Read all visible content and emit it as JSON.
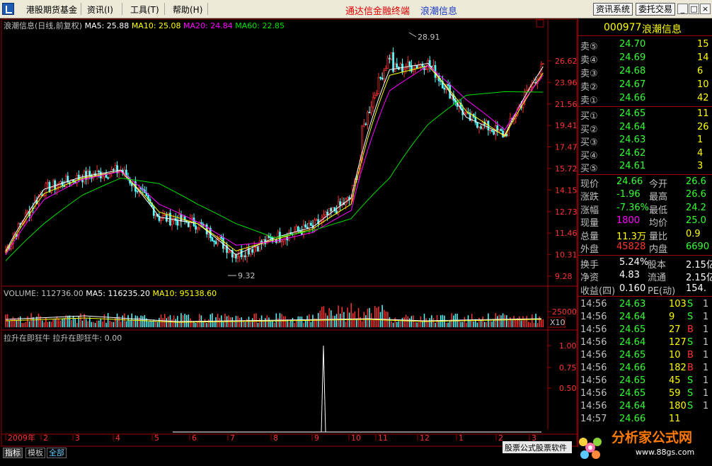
{
  "menu": {
    "items": [
      "港股期货基金",
      "资讯(I)",
      "工具(T)",
      "帮助(H)"
    ],
    "title_red": "通达信金融终端",
    "title_blue": "浪潮信息",
    "buttons": [
      "资讯系统",
      "委托交易"
    ],
    "window_controls": [
      "_",
      "□",
      "×"
    ]
  },
  "chart": {
    "header": {
      "name": "浪潮信息(日线,前复权)",
      "ma5": "MA5: 25.88",
      "ma10": "MA10: 25.08",
      "ma20": "MA20: 24.84",
      "ma60": "MA60: 22.85"
    },
    "price_ticks": [
      "26.62",
      "23.96",
      "21.56",
      "19.41",
      "17.47",
      "15.72",
      "14.15",
      "12.73",
      "11.46",
      "10.31",
      "9.28"
    ],
    "high_label": "28.91",
    "low_label": "9.32",
    "volume_header": {
      "vol": "VOLUME: 112736.00",
      "ma5": "MA5: 116235.20",
      "ma10": "MA10: 95138.60"
    },
    "volume_tick": "25000",
    "volume_unit": "X10",
    "indicator_header": "拉升在即狂牛  拉升在即狂牛: 0.00",
    "indicator_ticks": [
      "1.00",
      "0.75",
      "0.50"
    ],
    "months": [
      "2009年",
      "2",
      "3",
      "4",
      "5",
      "6",
      "7",
      "8",
      "9",
      "10",
      "11",
      "12",
      "1",
      "2",
      "3"
    ],
    "colors": {
      "up": "#ff3333",
      "down": "#54ffff",
      "ma5": "#ffffff",
      "ma10": "#ffff00",
      "ma20": "#ff00ff",
      "ma60": "#00e000",
      "grid": "#a00000"
    }
  },
  "chart_data": {
    "type": "line",
    "title": "浪潮信息(日线,前复权)",
    "ylim": [
      9.28,
      28.91
    ],
    "categories": [
      "2009-01",
      "2009-02",
      "2009-03",
      "2009-04",
      "2009-05",
      "2009-06",
      "2009-07",
      "2009-08",
      "2009-09",
      "2009-10",
      "2009-11",
      "2009-12",
      "2010-01",
      "2010-02",
      "2010-03"
    ],
    "series": [
      {
        "name": "MA5",
        "values": [
          10.5,
          14.2,
          15.1,
          15.6,
          12.4,
          12.0,
          10.3,
          11.2,
          11.8,
          13.6,
          25.5,
          26.3,
          20.2,
          18.5,
          25.88
        ]
      },
      {
        "name": "MA10",
        "values": [
          10.4,
          13.9,
          15.0,
          15.5,
          12.7,
          12.0,
          10.5,
          11.1,
          11.7,
          13.2,
          24.8,
          26.0,
          20.8,
          18.4,
          25.08
        ]
      },
      {
        "name": "MA20",
        "values": [
          10.3,
          13.5,
          14.9,
          15.5,
          13.2,
          12.1,
          10.8,
          11.0,
          11.5,
          12.8,
          23.0,
          26.0,
          22.0,
          19.0,
          24.84
        ]
      },
      {
        "name": "MA60",
        "values": [
          10.0,
          12.0,
          13.8,
          15.0,
          14.6,
          13.2,
          12.0,
          11.2,
          11.6,
          12.3,
          15.0,
          19.5,
          22.5,
          22.9,
          22.85
        ]
      }
    ],
    "indicator": {
      "name": "拉升在即狂牛",
      "signal_month": "2009-09",
      "value": 1.0
    }
  },
  "quote": {
    "code": "000977",
    "name": "浪潮信息",
    "sell": [
      {
        "label": "卖⑤",
        "price": "24.70",
        "vol": "15"
      },
      {
        "label": "卖④",
        "price": "24.69",
        "vol": "14"
      },
      {
        "label": "卖③",
        "price": "24.68",
        "vol": "6"
      },
      {
        "label": "卖②",
        "price": "24.67",
        "vol": "10"
      },
      {
        "label": "卖①",
        "price": "24.66",
        "vol": "42"
      }
    ],
    "buy": [
      {
        "label": "买①",
        "price": "24.65",
        "vol": "11"
      },
      {
        "label": "买②",
        "price": "24.64",
        "vol": "26"
      },
      {
        "label": "买③",
        "price": "24.63",
        "vol": "1"
      },
      {
        "label": "买④",
        "price": "24.62",
        "vol": "4"
      },
      {
        "label": "买⑤",
        "price": "24.61",
        "vol": "3"
      }
    ],
    "stats": [
      {
        "l1": "现价",
        "v1": "24.66",
        "c1": "#33ff33",
        "l2": "今开",
        "v2": "26.6",
        "c2": "#33ff33"
      },
      {
        "l1": "涨跌",
        "v1": "-1.96",
        "c1": "#33ff33",
        "l2": "最高",
        "v2": "26.6",
        "c2": "#33ff33"
      },
      {
        "l1": "涨幅",
        "v1": "-7.36%",
        "c1": "#33ff33",
        "l2": "最低",
        "v2": "24.2",
        "c2": "#33ff33"
      },
      {
        "l1": "现量",
        "v1": "1800",
        "c1": "#ff00ff",
        "l2": "均价",
        "v2": "25.0",
        "c2": "#33ff33"
      },
      {
        "l1": "总量",
        "v1": "11.3万",
        "c1": "#ffff00",
        "l2": "量比",
        "v2": "0.9",
        "c2": "#ffff00"
      },
      {
        "l1": "外盘",
        "v1": "45828",
        "c1": "#ff3333",
        "l2": "内盘",
        "v2": "6690",
        "c2": "#33ff33"
      }
    ],
    "fin": [
      {
        "l1": "换手",
        "v1": "5.24%",
        "l2": "股本",
        "v2": "2.15亿"
      },
      {
        "l1": "净资",
        "v1": "4.83",
        "l2": "流通",
        "v2": "2.15亿"
      },
      {
        "l1": "收益(四)",
        "v1": "0.160",
        "l2": "PE(动)",
        "v2": "154."
      }
    ],
    "ticks": [
      {
        "time": "14:56",
        "price": "24.63",
        "vol": "103",
        "side": "S",
        "n": "1"
      },
      {
        "time": "14:56",
        "price": "24.64",
        "vol": "9",
        "side": "S",
        "n": "1"
      },
      {
        "time": "14:56",
        "price": "24.65",
        "vol": "27",
        "side": "B",
        "n": "1"
      },
      {
        "time": "14:56",
        "price": "24.64",
        "vol": "127",
        "side": "S",
        "n": "1"
      },
      {
        "time": "14:56",
        "price": "24.65",
        "vol": "10",
        "side": "B",
        "n": "1"
      },
      {
        "time": "14:56",
        "price": "24.66",
        "vol": "182",
        "side": "B",
        "n": "1"
      },
      {
        "time": "14:56",
        "price": "24.65",
        "vol": "45",
        "side": "S",
        "n": "1"
      },
      {
        "time": "14:56",
        "price": "24.65",
        "vol": "59",
        "side": "S",
        "n": "1"
      },
      {
        "time": "14:56",
        "price": "24.64",
        "vol": "180",
        "side": "S",
        "n": "1"
      },
      {
        "time": "14:57",
        "price": "24.66",
        "vol": "11",
        "side": "",
        "n": ""
      }
    ]
  },
  "bottom": {
    "tabs": [
      "指标",
      "模板",
      "全部"
    ],
    "scroller": "股票公式股票软件"
  },
  "watermark": {
    "text": "分析家公式网",
    "url": "www.88gs.com"
  }
}
